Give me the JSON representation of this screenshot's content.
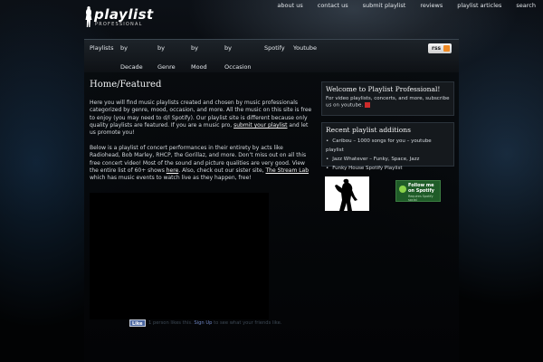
{
  "logo": {
    "word": "playlist",
    "sub": "PROFESSIONAL"
  },
  "top_nav": [
    "about us",
    "contact us",
    "submit playlist",
    "reviews",
    "playlist articles",
    "search"
  ],
  "main_nav": [
    {
      "l1": "Playlists",
      "l2": ""
    },
    {
      "l1": "by",
      "l2": "Decade"
    },
    {
      "l1": "by",
      "l2": "Genre"
    },
    {
      "l1": "by",
      "l2": "Mood"
    },
    {
      "l1": "by",
      "l2": "Occasion"
    },
    {
      "l1": "Spotify",
      "l2": ""
    },
    {
      "l1": "Youtube",
      "l2": ""
    }
  ],
  "rss_label": "rss",
  "page_title": "Home/Featured",
  "intro": {
    "before": "Here you will find music playlists created and chosen by music professionals categorized by genre, mood, occasion, and more. All the music on this site is free to enjoy (you may need to d/l Spotify).  Our playlist site is different because only quality playlists are featured. If you are a music pro, ",
    "link": "submit your playlist",
    "after": " and let us promote you!"
  },
  "concerts": {
    "before": "Below is a playlist of concert performances in their entirety by acts like Radiohead, Bob Marley, RHCP, the Gorillaz, and more. Don’t miss out on all this free concert video! Most of the sound and picture qualities are very good. View the entire list of 60+ shows ",
    "here": "here",
    "middle": ". Also, check out our sister site, ",
    "link": "The Stream Lab",
    "after": " which has music events to watch live as they happen, free!"
  },
  "facebook": {
    "like_label": "Like",
    "text": "1 person likes this. ",
    "signup": "Sign Up",
    "text_after": " to see what your friends like."
  },
  "sidebar": {
    "welcome_title": "Welcome to Playlist Professional!",
    "welcome_text": "For video playlists, concerts, and more, subscribe us on youtube.",
    "recent_title": "Recent playlist additions",
    "recent_items": [
      "Caribou – 1000 songs for you – youtube playlist",
      "Jazz Whatever – Funky, Space, Jazz",
      "Funky House Spotify Playlist"
    ],
    "spotify_badge": {
      "line1": "Follow me",
      "line2": "on Spotify",
      "sub": "Requires Spotify social"
    }
  }
}
